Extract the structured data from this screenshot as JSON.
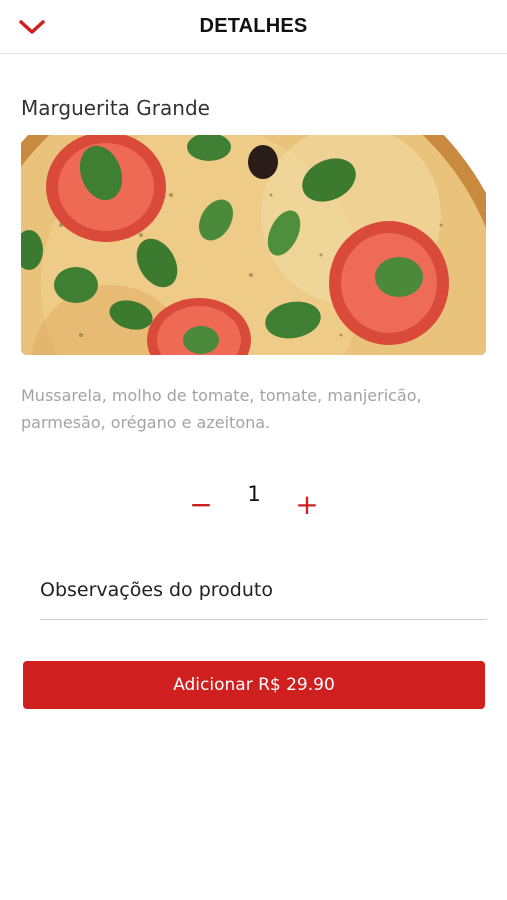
{
  "header": {
    "title": "DETALHES",
    "back_icon": "chevron-down-icon"
  },
  "product": {
    "name": "Marguerita Grande",
    "description": "Mussarela, molho de tomate, tomate, manjericão, parmesão, orégano e azeitona.",
    "image": "pizza-margherita-photo"
  },
  "quantity": {
    "minus_label": "−",
    "value": "1",
    "plus_label": "+"
  },
  "notes": {
    "label": "Observações do produto"
  },
  "add_button": {
    "label": "Adicionar R$ 29.90"
  },
  "colors": {
    "accent": "#cf1f1f",
    "muted_text": "#a3a3a3"
  }
}
